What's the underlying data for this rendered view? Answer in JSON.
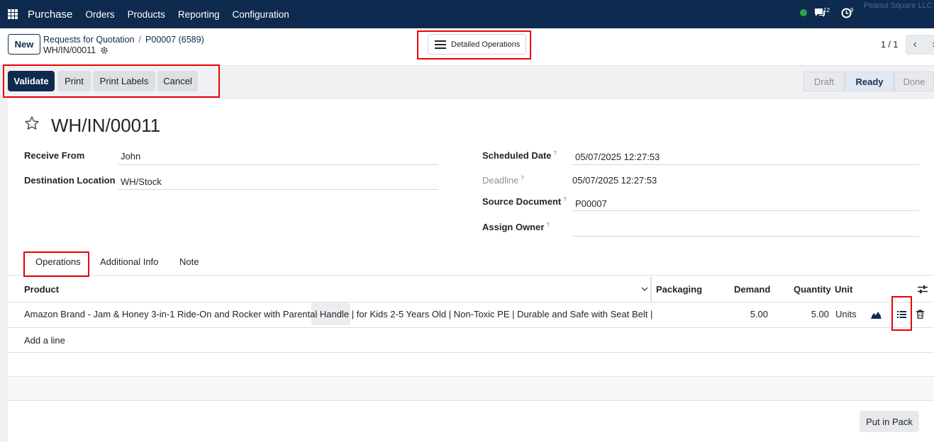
{
  "navbar": {
    "app_name": "Purchase",
    "menu": [
      "Orders",
      "Products",
      "Reporting",
      "Configuration"
    ],
    "messages_count": "12",
    "activities_count": "9",
    "company": "Peanut Square LLC"
  },
  "control_panel": {
    "new_label": "New",
    "breadcrumb": [
      "Requests for Quotation",
      "P00007 (6589)"
    ],
    "record_name": "WH/IN/00011",
    "detailed_operations_label": "Detailed Operations",
    "pager": "1 / 1"
  },
  "statusbar": {
    "actions": [
      "Validate",
      "Print",
      "Print Labels",
      "Cancel"
    ],
    "stages": [
      "Draft",
      "Ready",
      "Done"
    ],
    "active_stage": "Ready"
  },
  "form": {
    "title": "WH/IN/00011",
    "receive_from_label": "Receive From",
    "receive_from": "John",
    "destination_label": "Destination Location",
    "destination": "WH/Stock",
    "scheduled_date_label": "Scheduled Date",
    "scheduled_date": "05/07/2025 12:27:53",
    "deadline_label": "Deadline",
    "deadline": "05/07/2025 12:27:53",
    "source_document_label": "Source Document",
    "source_document": "P00007",
    "assign_owner_label": "Assign Owner",
    "assign_owner": "",
    "tooltip_marker": "?"
  },
  "tabs": [
    "Operations",
    "Additional Info",
    "Note"
  ],
  "table": {
    "columns": [
      "Product",
      "Packaging",
      "Demand",
      "Quantity",
      "Unit"
    ],
    "rows": [
      {
        "product": "Amazon Brand - Jam & Honey 3-in-1 Ride-On and Rocker with Parental Handle | for Kids 2-5 Years Old | Non-Toxic PE | Durable and Safe with Seat Belt |",
        "packaging": "",
        "demand": "5.00",
        "quantity": "5.00",
        "unit": "Units"
      }
    ],
    "add_line_label": "Add a line"
  },
  "footer": {
    "put_in_pack_label": "Put in Pack"
  },
  "colors": {
    "navbar": "#0f2a4f",
    "primary": "#0f2a4f",
    "highlight_box": "#ee0000",
    "status_online": "#28a745"
  }
}
